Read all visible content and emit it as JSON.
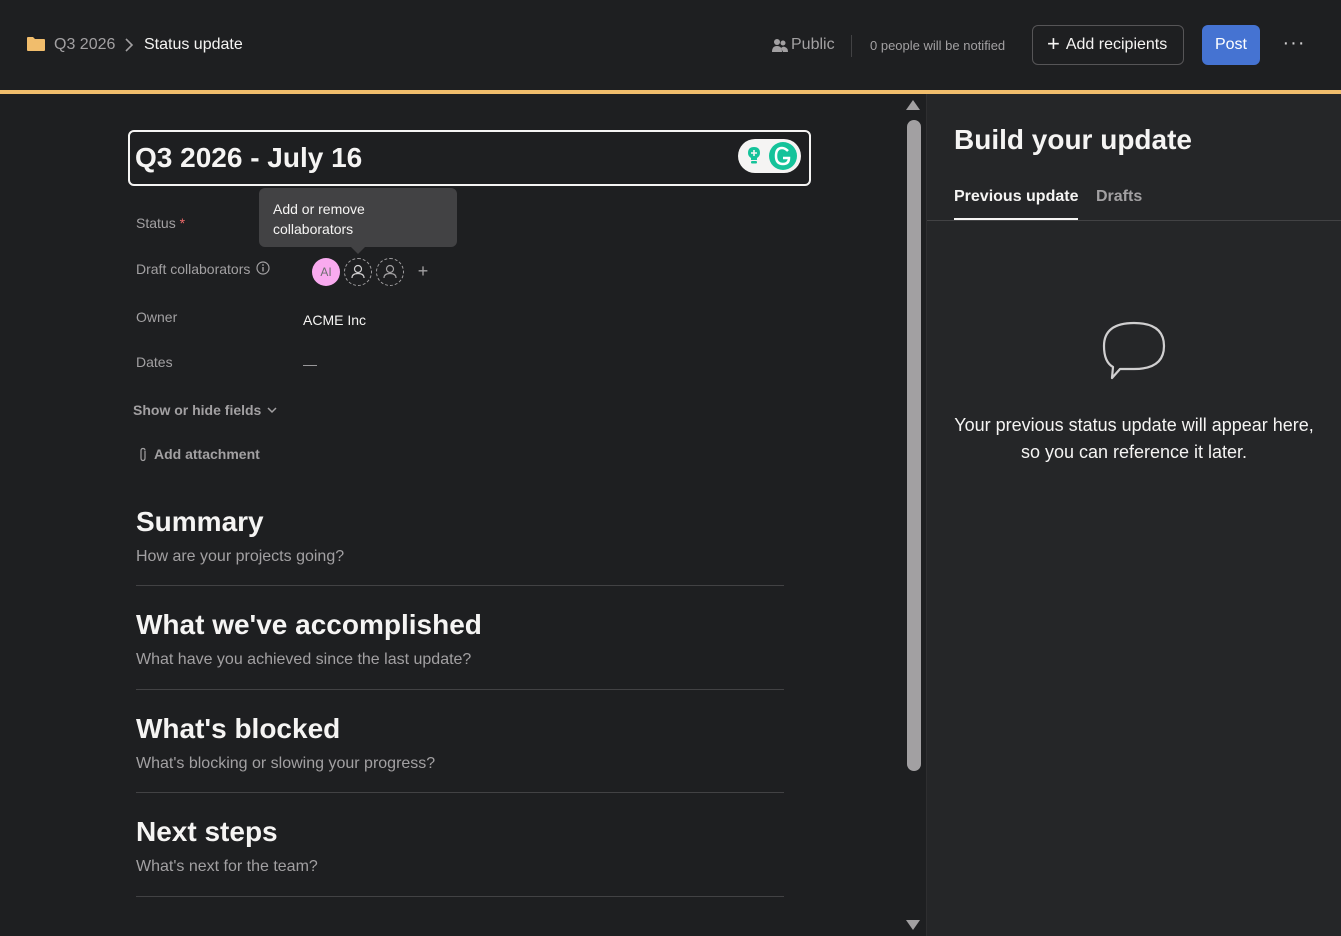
{
  "breadcrumb": {
    "parent": "Q3 2026",
    "current": "Status update"
  },
  "header": {
    "visibility_label": "Public",
    "notify_text": "0 people will be notified",
    "add_recipients_label": "Add recipients",
    "post_label": "Post",
    "more_label": "···"
  },
  "editor": {
    "title": "Q3 2026 - July 16",
    "fields": {
      "status_label": "Status",
      "status_required_mark": "*",
      "collaborators_label": "Draft collaborators",
      "owner_label": "Owner",
      "owner_value": "ACME Inc",
      "dates_label": "Dates",
      "dates_value": "—"
    },
    "tooltip": "Add or remove collaborators",
    "collaborator_initials": "AI",
    "add_collaborator_label": "+",
    "show_hide_label": "Show or hide fields",
    "attachment_label": "Add attachment",
    "sections": [
      {
        "title": "Summary",
        "hint": "How are your projects going?"
      },
      {
        "title": "What we've accomplished",
        "hint": "What have you achieved since the last update?"
      },
      {
        "title": "What's blocked",
        "hint": "What's blocking or slowing your progress?"
      },
      {
        "title": "Next steps",
        "hint": "What's next for the team?"
      }
    ]
  },
  "side_panel": {
    "title": "Build your update",
    "tabs": [
      {
        "label": "Previous update",
        "active": true
      },
      {
        "label": "Drafts",
        "active": false
      }
    ],
    "empty_message": "Your previous status update will appear here, so you can reference it later."
  },
  "colors": {
    "background": "#1e1f21",
    "panel": "#252628",
    "accent_line": "#f1bd6c",
    "primary_button": "#4573d2",
    "avatar": "#f9aaef",
    "grammarly": "#15c39a"
  },
  "icons": [
    "folder-icon",
    "chevron-right-icon",
    "people-icon",
    "plus-icon",
    "more-icon",
    "lightbulb-icon",
    "grammarly-icon",
    "info-icon",
    "user-icon",
    "chevron-down-icon",
    "paperclip-icon",
    "speech-bubble-icon"
  ]
}
